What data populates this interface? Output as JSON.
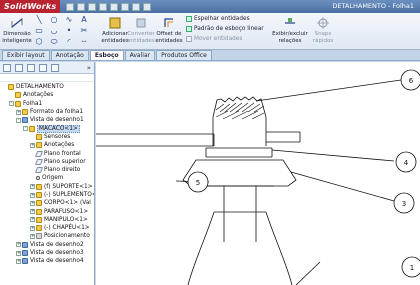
{
  "app": {
    "logo": "SolidWorks",
    "doc_title": "DETALHAMENTO - Folha1"
  },
  "ribbon": {
    "dimension_label": "Dimensão\ninteligente",
    "mirror_label": "Espelhar entidades",
    "linear_pattern_label": "Padrão de esboço linear",
    "move_label": "Mover entidades",
    "add_relations_label": "Adicionar\nentidades",
    "convert_label": "Converter\nentidades",
    "offset_label": "Offset de\nentidades",
    "display_relations_label": "Exibir/excluir\nrelações",
    "quick_snaps_label": "Snaps\nrápidos"
  },
  "tabs": [
    {
      "label": "Exibir layout",
      "active": false
    },
    {
      "label": "Anotação",
      "active": false
    },
    {
      "label": "Esboço",
      "active": true
    },
    {
      "label": "Avaliar",
      "active": false
    },
    {
      "label": "Produtos Office",
      "active": false
    }
  ],
  "tree": [
    {
      "label": "DETALHAMENTO",
      "indent": 0,
      "expander": "",
      "icon": "drawing-icon"
    },
    {
      "label": "Anotações",
      "indent": 1,
      "expander": "",
      "icon": "annotations-icon"
    },
    {
      "label": "Folha1",
      "indent": 1,
      "expander": "-",
      "icon": "sheet-icon"
    },
    {
      "label": "Formato da folha1",
      "indent": 2,
      "expander": "+",
      "icon": "sheet-format-icon"
    },
    {
      "label": "Vista de desenho1",
      "indent": 2,
      "expander": "-",
      "icon": "drawing-view-icon"
    },
    {
      "label": "MACACO<1>",
      "indent": 3,
      "expander": "-",
      "icon": "assembly-icon",
      "selected": true
    },
    {
      "label": "Sensores",
      "indent": 4,
      "expander": "",
      "icon": "sensors-icon"
    },
    {
      "label": "Anotações",
      "indent": 4,
      "expander": "+",
      "icon": "annotations-icon"
    },
    {
      "label": "Plano frontal",
      "indent": 4,
      "expander": "",
      "icon": "plane-icon"
    },
    {
      "label": "Plano superior",
      "indent": 4,
      "expander": "",
      "icon": "plane-icon"
    },
    {
      "label": "Plano direito",
      "indent": 4,
      "expander": "",
      "icon": "plane-icon"
    },
    {
      "label": "Origem",
      "indent": 4,
      "expander": "",
      "icon": "origin-icon"
    },
    {
      "label": "(f) SUPORTE<1>",
      "indent": 4,
      "expander": "+",
      "icon": "part-icon"
    },
    {
      "label": "(-) SUPLEMENTO<1>",
      "indent": 4,
      "expander": "+",
      "icon": "part-icon"
    },
    {
      "label": "CORPO<1> (Val",
      "indent": 4,
      "expander": "+",
      "icon": "part-icon"
    },
    {
      "label": "PARAFUSO<1>",
      "indent": 4,
      "expander": "+",
      "icon": "part-icon"
    },
    {
      "label": "MANIPULO<1>",
      "indent": 4,
      "expander": "+",
      "icon": "part-icon"
    },
    {
      "label": "(-) CHAPÉU<1>",
      "indent": 4,
      "expander": "+",
      "icon": "part-icon"
    },
    {
      "label": "Posicionamento",
      "indent": 4,
      "expander": "+",
      "icon": "mates-icon"
    },
    {
      "label": "Vista de desenho2",
      "indent": 2,
      "expander": "+",
      "icon": "drawing-view-icon"
    },
    {
      "label": "Vista de desenho3",
      "indent": 2,
      "expander": "+",
      "icon": "drawing-view-icon"
    },
    {
      "label": "Vista de desenho4",
      "indent": 2,
      "expander": "+",
      "icon": "drawing-view-icon"
    }
  ],
  "balloons": [
    "6",
    "4",
    "5",
    "3",
    "1"
  ],
  "colors": {
    "selection": "#c5d9f2",
    "ribbon_bg": "#dfe8f3",
    "logo_bg": "#b8232f"
  }
}
